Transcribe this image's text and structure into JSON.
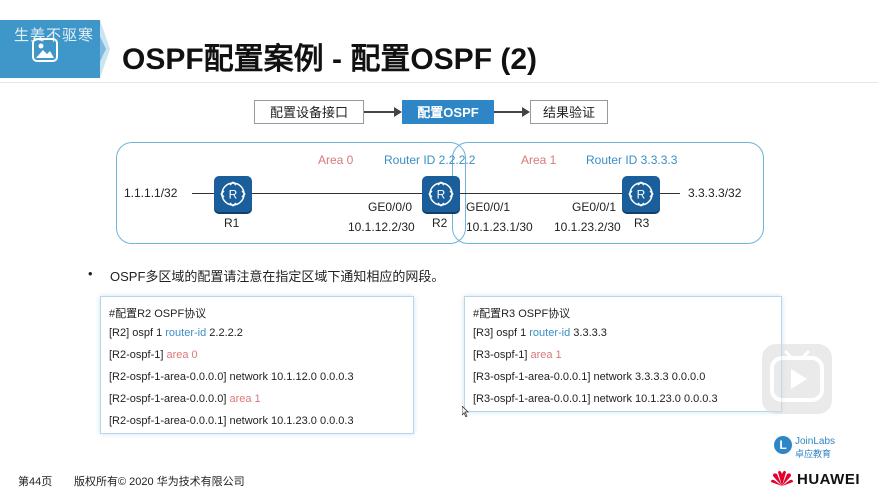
{
  "header": {
    "watermark": "生姜不驱寒",
    "title": "OSPF配置案例 - 配置OSPF (2)"
  },
  "steps": [
    "配置设备接口",
    "配置OSPF",
    "结果验证"
  ],
  "topology": {
    "area0_label": "Area 0",
    "area1_label": "Area 1",
    "r2_router_id": "Router ID 2.2.2.2",
    "r3_router_id": "Router ID 3.3.3.3",
    "left_net": "1.1.1.1/32",
    "right_net": "3.3.3.3/32",
    "r1": "R1",
    "r2": "R2",
    "r3": "R3",
    "r2_left_if": "GE0/0/0",
    "r2_left_ip": "10.1.12.2/30",
    "r2_right_if": "GE0/0/1",
    "r2_right_ip": "10.1.23.1/30",
    "r3_if": "GE0/0/1",
    "r3_ip": "10.1.23.2/30",
    "router_symbol": "R"
  },
  "bullet": "OSPF多区域的配置请注意在指定区域下通知相应的网段。",
  "config_r2": {
    "heading": "#配置R2 OSPF协议",
    "l1_prefix": "[R2] ospf 1 ",
    "l1_kw": "router-id",
    "l1_val": " 2.2.2.2",
    "l2_prefix": "[R2-ospf-1] ",
    "l2_kw": "area 0",
    "l3": "[R2-ospf-1-area-0.0.0.0] network 10.1.12.0 0.0.0.3",
    "l4_prefix": "[R2-ospf-1-area-0.0.0.0] ",
    "l4_kw": "area 1",
    "l5": "[R2-ospf-1-area-0.0.0.1] network 10.1.23.0 0.0.0.3"
  },
  "config_r3": {
    "heading": "#配置R3 OSPF协议",
    "l1_prefix": "[R3] ospf 1 ",
    "l1_kw": "router-id",
    "l1_val": " 3.3.3.3",
    "l2_prefix": "[R3-ospf-1] ",
    "l2_kw": "area 1",
    "l3": "[R3-ospf-1-area-0.0.0.1] network 3.3.3.3 0.0.0.0",
    "l4": "[R3-ospf-1-area-0.0.0.1] network 10.1.23.0 0.0.0.3"
  },
  "footer": {
    "page": "第44页",
    "copyright": "版权所有© 2020 华为技术有限公司",
    "joinlabs": "JoinLabs",
    "joinlabs_cn": "卓应教育",
    "brand": "HUAWEI"
  },
  "colors": {
    "accent": "#2f86c6",
    "area_label": "#d9797a",
    "router": "#1a5f9b"
  }
}
